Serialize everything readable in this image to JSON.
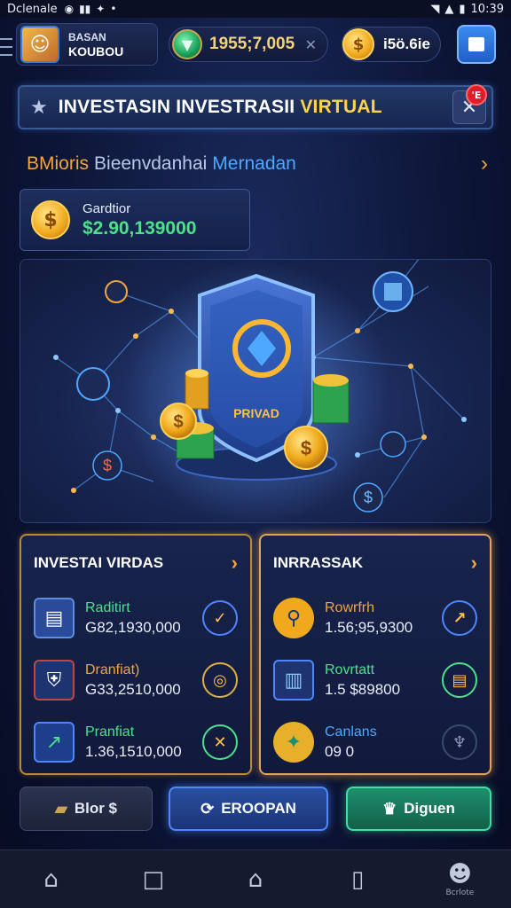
{
  "status_bar": {
    "carrier": "Dclenale",
    "time": "10:39"
  },
  "profile": {
    "line1": "BASAN",
    "line2": "KOUBOU"
  },
  "currency": {
    "gems": "1955;7,005",
    "coins": "i5ö.6ie"
  },
  "banner": {
    "title_main": "INVESTASIN INVESTRASII",
    "title_highlight": "VIRTUAL",
    "badge": "'E"
  },
  "subheader": {
    "part1": "BMioris",
    "part2": "Bieenvdanhai",
    "part3": "Mernadan"
  },
  "balance": {
    "label": "Gardtior",
    "value": "$2.90,139000"
  },
  "hero": {
    "sign_text": "PRIVAD"
  },
  "panels": {
    "left": {
      "title": "INVESTAI VIRDAS",
      "rows": [
        {
          "name": "Raditirt",
          "value": "G82,1930,000",
          "name_color": "#4ee08a"
        },
        {
          "name": "Dranfiat)",
          "value": "G33,2510,000",
          "name_color": "#f2a53c"
        },
        {
          "name": "Pranfiat",
          "value": "1.36,1510,000",
          "name_color": "#4ee08a"
        }
      ]
    },
    "right": {
      "title": "INRRASSAK",
      "rows": [
        {
          "name": "Rowrfrh",
          "value": "1.56;95,9300",
          "name_color": "#f2a53c"
        },
        {
          "name": "Rovrtatt",
          "value": "1.5 $89800",
          "name_color": "#4ee08a"
        },
        {
          "name": "Canlans",
          "value": "09 0",
          "name_color": "#4fa8ff"
        }
      ]
    }
  },
  "actions": {
    "a1": "Blor $",
    "a2": "EROOPAN",
    "a3": "Diguen"
  },
  "navbar": {
    "profile_label": "Bcrlote"
  },
  "colors": {
    "accent_gold": "#f2a53c",
    "accent_green": "#4ee08a",
    "accent_blue": "#4f86ff"
  }
}
